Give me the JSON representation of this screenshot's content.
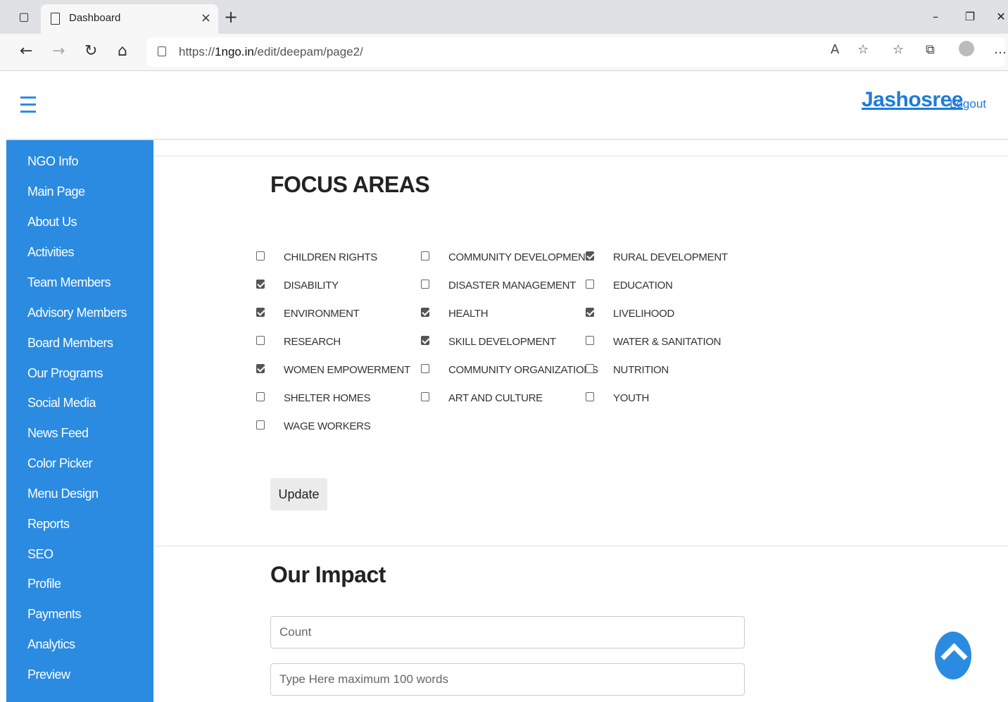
{
  "browser": {
    "tab_title": "Dashboard",
    "url_prefix": "https://",
    "url_host": "1ngo.in",
    "url_path": "/edit/deepam/page2/"
  },
  "header": {
    "user_name": "Jashosree",
    "logout_label": "Logout"
  },
  "sidebar": {
    "items": [
      {
        "label": "NGO Info"
      },
      {
        "label": "Main Page"
      },
      {
        "label": "About Us"
      },
      {
        "label": "Activities"
      },
      {
        "label": "Team Members"
      },
      {
        "label": "Advisory Members"
      },
      {
        "label": "Board Members"
      },
      {
        "label": "Our Programs"
      },
      {
        "label": "Social Media"
      },
      {
        "label": "News Feed"
      },
      {
        "label": "Color Picker"
      },
      {
        "label": "Menu Design"
      },
      {
        "label": "Reports"
      },
      {
        "label": "SEO"
      },
      {
        "label": "Profile"
      },
      {
        "label": "Payments"
      },
      {
        "label": "Analytics"
      },
      {
        "label": "Preview"
      }
    ]
  },
  "focus_areas": {
    "title": "FOCUS AREAS",
    "options": [
      {
        "label": "CHILDREN RIGHTS",
        "checked": false
      },
      {
        "label": "COMMUNITY DEVELOPMENT",
        "checked": false
      },
      {
        "label": "RURAL DEVELOPMENT",
        "checked": true
      },
      {
        "label": "DISABILITY",
        "checked": true
      },
      {
        "label": "DISASTER MANAGEMENT",
        "checked": false
      },
      {
        "label": "EDUCATION",
        "checked": false
      },
      {
        "label": "ENVIRONMENT",
        "checked": true
      },
      {
        "label": "HEALTH",
        "checked": true
      },
      {
        "label": "LIVELIHOOD",
        "checked": true
      },
      {
        "label": "RESEARCH",
        "checked": false
      },
      {
        "label": "SKILL DEVELOPMENT",
        "checked": true
      },
      {
        "label": "WATER & SANITATION",
        "checked": false
      },
      {
        "label": "WOMEN EMPOWERMENT",
        "checked": true
      },
      {
        "label": "COMMUNITY ORGANIZATIONS",
        "checked": false
      },
      {
        "label": "NUTRITION",
        "checked": false
      },
      {
        "label": "SHELTER HOMES",
        "checked": false
      },
      {
        "label": "ART AND CULTURE",
        "checked": false
      },
      {
        "label": "YOUTH",
        "checked": false
      },
      {
        "label": "WAGE WORKERS",
        "checked": false
      }
    ],
    "update_label": "Update"
  },
  "impact": {
    "title": "Our Impact",
    "count_placeholder": "Count",
    "text_placeholder": "Type Here maximum 100 words"
  },
  "icons": {
    "scroll_top": "chevron-up-icon",
    "accent_color": "#2b8be1"
  }
}
